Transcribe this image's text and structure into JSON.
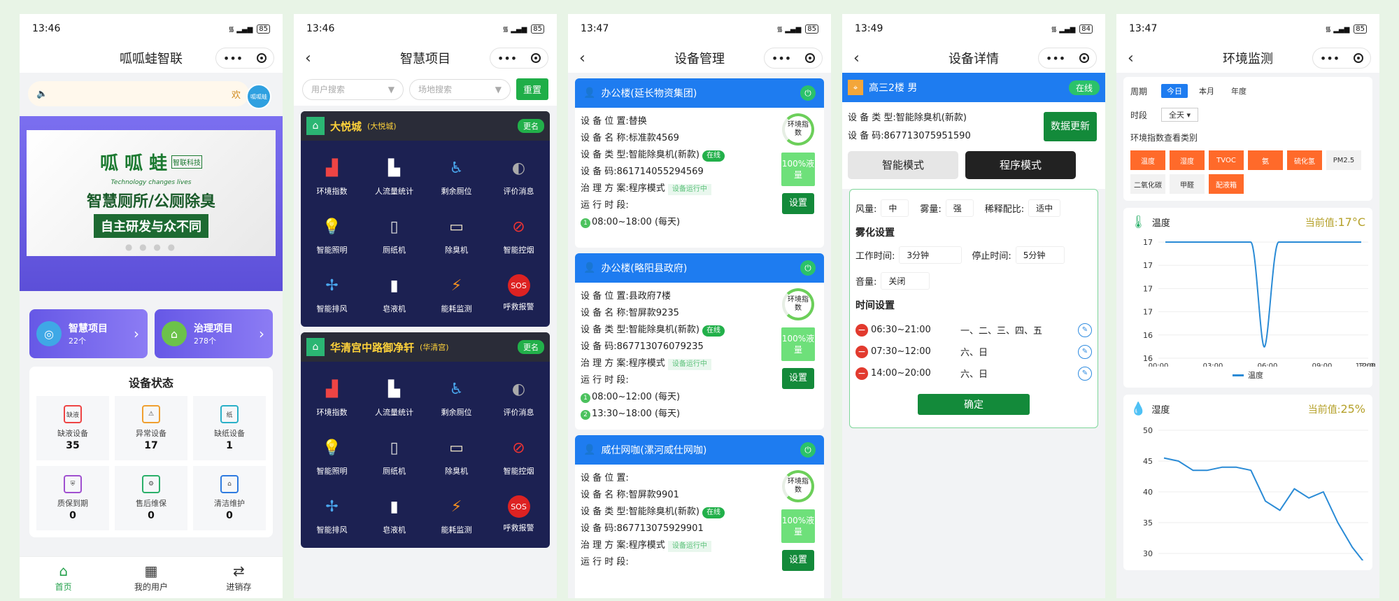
{
  "p1": {
    "time": "13:46",
    "battery": "85",
    "title": "呱呱蛙智联",
    "notice": "欢",
    "avatar": "呱呱蛙",
    "banner": {
      "brand": "呱 呱 蛙",
      "tag": "智联科技",
      "tagline": "Technology changes lives",
      "slogan": "智慧厕所/公厕除臭",
      "slogan2": "自主研发与众不同",
      "dots": "● ● ● ●"
    },
    "cards": [
      {
        "title": "智慧项目",
        "sub": "22个"
      },
      {
        "title": "治理项目",
        "sub": "278个"
      }
    ],
    "status_title": "设备状态",
    "status": [
      {
        "label": "缺液设备",
        "value": "35",
        "icon": "缺液"
      },
      {
        "label": "异常设备",
        "value": "17",
        "icon": "⚠"
      },
      {
        "label": "缺纸设备",
        "value": "1",
        "icon": "纸"
      },
      {
        "label": "质保到期",
        "value": "0",
        "icon": "⛨"
      },
      {
        "label": "售后维保",
        "value": "0",
        "icon": "⚙"
      },
      {
        "label": "清洁维护",
        "value": "0",
        "icon": "⌂"
      }
    ],
    "tabs": [
      {
        "label": "首页",
        "icon": "⌂"
      },
      {
        "label": "我的用户",
        "icon": "▦"
      },
      {
        "label": "进销存",
        "icon": "⇄"
      }
    ]
  },
  "p2": {
    "time": "13:46",
    "battery": "85",
    "title": "智慧项目",
    "user_search": "用户搜索",
    "site_search": "场地搜索",
    "reset": "重置",
    "projects": [
      {
        "name": "大悦城",
        "sub": "(大悦城)",
        "rename": "更名"
      },
      {
        "name": "华清宫中路御净轩",
        "sub": "(华清宫)",
        "rename": "更名"
      }
    ],
    "features": [
      {
        "label": "环境指数",
        "icon": "▟"
      },
      {
        "label": "人流量统计",
        "icon": "▙"
      },
      {
        "label": "剩余厕位",
        "icon": "♿"
      },
      {
        "label": "评价消息",
        "icon": "◐"
      },
      {
        "label": "智能照明",
        "icon": "💡"
      },
      {
        "label": "厕纸机",
        "icon": "▯"
      },
      {
        "label": "除臭机",
        "icon": "▭"
      },
      {
        "label": "智能控烟",
        "icon": "⊘"
      },
      {
        "label": "智能排风",
        "icon": "✢"
      },
      {
        "label": "皂液机",
        "icon": "▮"
      },
      {
        "label": "能耗监测",
        "icon": "⚡"
      },
      {
        "label": "呼救报警",
        "icon": "SOS"
      }
    ]
  },
  "p3": {
    "time": "13:47",
    "battery": "85",
    "title": "设备管理",
    "ring": "环境指数",
    "liquid": "100%液量",
    "set": "设置",
    "online": "在线",
    "running": "设备运行中",
    "devices": [
      {
        "header": "办公楼(延长物资集团)",
        "location": "设 备 位 置:替换",
        "name": "设 备 名 称:标准款4569",
        "type": "设 备 类 型:智能除臭机(新款)",
        "code": "设     备     码:861714055294569",
        "plan": "治 理 方 案:程序模式",
        "period": "运 行 时 段:",
        "times": [
          "08:00~18:00 (每天)"
        ]
      },
      {
        "header": "办公楼(略阳县政府)",
        "location": "设 备 位 置:县政府7楼",
        "name": "设 备 名 称:智屏款9235",
        "type": "设 备 类 型:智能除臭机(新款)",
        "code": "设     备     码:867713076079235",
        "plan": "治 理 方 案:程序模式",
        "period": "运 行 时 段:",
        "times": [
          "08:00~12:00 (每天)",
          "13:30~18:00 (每天)"
        ]
      },
      {
        "header": "威仕网咖(漯河威仕网咖)",
        "location": "设 备 位 置:",
        "name": "设 备 名 称:智屏款9901",
        "type": "设 备 类 型:智能除臭机(新款)",
        "code": "设     备     码:867713075929901",
        "plan": "治 理 方 案:程序模式",
        "period": "运 行 时 段:",
        "times": []
      }
    ]
  },
  "p4": {
    "time": "13:49",
    "battery": "84",
    "title": "设备详情",
    "header": "高三2楼 男",
    "online": "在线",
    "type": "设 备 类 型:智能除臭机(新款)",
    "code": "设     备     码:867713075951590",
    "update": "数据更新",
    "mode_smart": "智能模式",
    "mode_prog": "程序模式",
    "wind_label": "风量:",
    "wind": "中",
    "mist_label": "雾量:",
    "mist": "强",
    "ratio_label": "稀释配比:",
    "ratio": "适中",
    "mist_title": "雾化设置",
    "work_label": "工作时间:",
    "work": "3分钟",
    "stop_label": "停止时间:",
    "stop": "5分钟",
    "vol_label": "音量:",
    "vol": "关闭",
    "time_title": "时间设置",
    "schedules": [
      {
        "range": "06:30~21:00",
        "days": "一、二、三、四、五"
      },
      {
        "range": "07:30~12:00",
        "days": "六、日"
      },
      {
        "range": "14:00~20:00",
        "days": "六、日"
      }
    ],
    "confirm": "确定"
  },
  "p5": {
    "time": "13:47",
    "battery": "85",
    "title": "环境监测",
    "period_label": "周期",
    "periods": [
      "今日",
      "本月",
      "年度"
    ],
    "slot_label": "时段",
    "slot": "全天 ▾",
    "cat_title": "环境指数查看类别",
    "cats": [
      {
        "label": "温度",
        "on": true
      },
      {
        "label": "湿度",
        "on": true
      },
      {
        "label": "TVOC",
        "on": true
      },
      {
        "label": "氨",
        "on": true
      },
      {
        "label": "硫化氢",
        "on": true
      },
      {
        "label": "PM2.5",
        "on": false
      },
      {
        "label": "二氧化碳",
        "on": false
      },
      {
        "label": "甲醛",
        "on": false
      },
      {
        "label": "配液箱",
        "on": true
      }
    ],
    "temp_title": "温度",
    "temp_cur_label": "当前值:",
    "temp_cur": "17°C",
    "hum_title": "湿度",
    "hum_cur_label": "当前值:",
    "hum_cur": "25%"
  },
  "chart_data": [
    {
      "type": "line",
      "title": "温度",
      "x": [
        "00:00",
        "03:00",
        "06:00",
        "06:30",
        "07:00",
        "09:00",
        "12:00",
        "13:00"
      ],
      "series": [
        {
          "name": "温度",
          "values": [
            17,
            17,
            17,
            16,
            17,
            17,
            17,
            17
          ]
        }
      ],
      "yticks": [
        "17",
        "17",
        "17",
        "17",
        "16",
        "16"
      ],
      "xticks": [
        "00:00",
        "03:00",
        "06:00",
        "09:00",
        "12:00",
        "13:00"
      ],
      "legend": "bottom"
    },
    {
      "type": "line",
      "title": "湿度",
      "x": [
        0,
        1,
        2,
        3,
        4,
        5,
        6,
        7,
        8,
        9,
        10,
        11,
        12,
        13,
        14
      ],
      "series": [
        {
          "values": [
            45.5,
            45,
            43.5,
            43.5,
            44,
            44,
            43.5,
            38.5,
            37,
            40.5,
            39,
            40,
            35,
            31,
            28
          ]
        }
      ],
      "yticks": [
        "50",
        "45",
        "40",
        "35",
        "30"
      ],
      "ylim": [
        28,
        50
      ]
    }
  ]
}
